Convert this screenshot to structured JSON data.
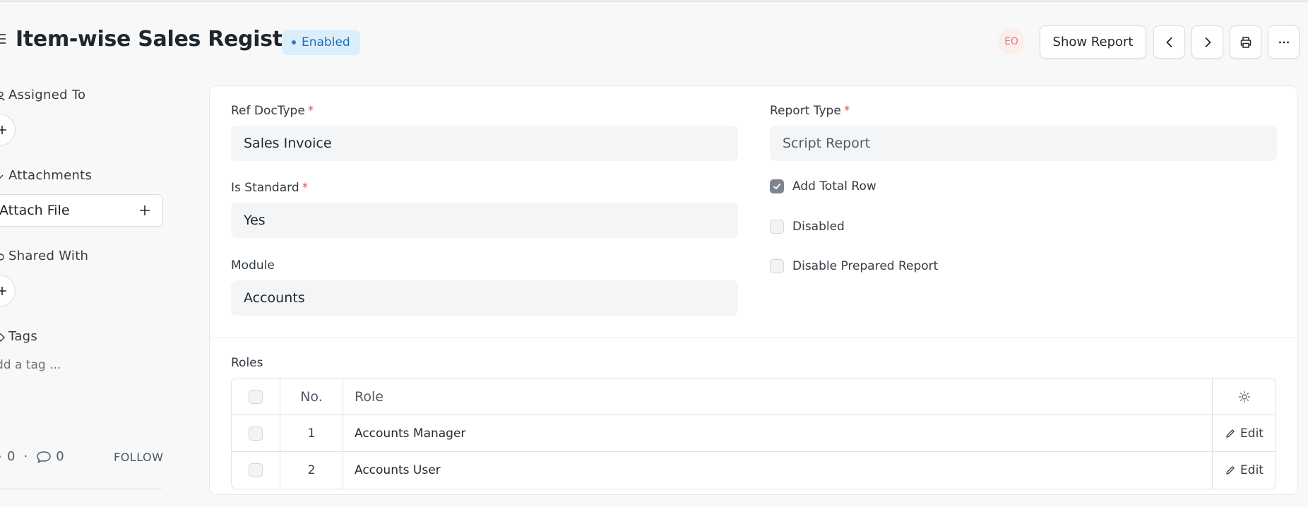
{
  "header": {
    "title": "Item-wise Sales Register",
    "status": "Enabled",
    "avatar_initials": "EO",
    "show_report_label": "Show Report"
  },
  "sidebar": {
    "assigned_to_label": "Assigned To",
    "attachments_label": "Attachments",
    "attach_file_label": "Attach File",
    "shared_with_label": "Shared With",
    "tags_label": "Tags",
    "tag_placeholder": "dd a tag ...",
    "likes_count": "0",
    "comments_count": "0",
    "separator": "·",
    "follow_label": "FOLLOW"
  },
  "form": {
    "ref_doctype": {
      "label": "Ref DocType",
      "value": "Sales Invoice"
    },
    "report_type": {
      "label": "Report Type",
      "value": "Script Report"
    },
    "is_standard": {
      "label": "Is Standard",
      "value": "Yes"
    },
    "module": {
      "label": "Module",
      "value": "Accounts"
    },
    "add_total_row": {
      "label": "Add Total Row",
      "checked": true
    },
    "disabled": {
      "label": "Disabled",
      "checked": false
    },
    "disable_prepared_report": {
      "label": "Disable Prepared Report",
      "checked": false
    },
    "required_mark": "*"
  },
  "roles": {
    "label": "Roles",
    "columns": {
      "no": "No.",
      "role": "Role"
    },
    "edit_label": "Edit",
    "rows": [
      {
        "no": "1",
        "role": "Accounts Manager"
      },
      {
        "no": "2",
        "role": "Accounts User"
      }
    ]
  },
  "colors": {
    "badge_bg": "#dbeefc",
    "badge_text": "#1e6fb4",
    "required": "#e24c4c",
    "avatar_text": "#e07a7a"
  }
}
